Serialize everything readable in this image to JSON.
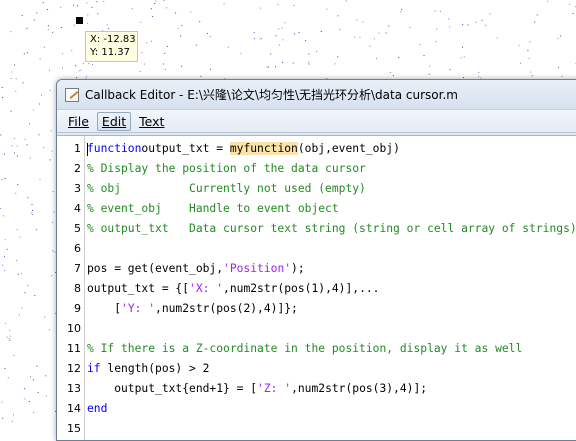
{
  "datatip": {
    "x_text": "X: -12.83",
    "y_text": "Y: 11.37"
  },
  "window": {
    "title": "Callback Editor - E:\\兴隆\\论文\\均匀性\\无挡光环分析\\data cursor.m"
  },
  "menu": {
    "file": "File",
    "edit": "Edit",
    "text": "Text"
  },
  "code": {
    "lines": [
      {
        "n": "1",
        "parts": [
          [
            "kw",
            "function"
          ],
          [
            "",
            "output_txt = "
          ],
          [
            "hl",
            "myfunction"
          ],
          [
            "",
            "(obj,event_obj)"
          ]
        ]
      },
      {
        "n": "2",
        "parts": [
          [
            "cm",
            "% Display the position of the data cursor"
          ]
        ]
      },
      {
        "n": "3",
        "parts": [
          [
            "cm",
            "% obj          Currently not used (empty)"
          ]
        ]
      },
      {
        "n": "4",
        "parts": [
          [
            "cm",
            "% event_obj    Handle to event object"
          ]
        ]
      },
      {
        "n": "5",
        "parts": [
          [
            "cm",
            "% output_txt   Data cursor text string (string or cell array of strings)."
          ]
        ]
      },
      {
        "n": "6",
        "parts": []
      },
      {
        "n": "7",
        "parts": [
          [
            "",
            "pos = get(event_obj,"
          ],
          [
            "st",
            "'Position'"
          ],
          [
            "",
            ");"
          ]
        ]
      },
      {
        "n": "8",
        "parts": [
          [
            "",
            "output_txt = {["
          ],
          [
            "st",
            "'X: '"
          ],
          [
            "",
            ",num2str(pos(1),4)],..."
          ]
        ]
      },
      {
        "n": "9",
        "parts": [
          [
            "",
            "    ["
          ],
          [
            "st",
            "'Y: '"
          ],
          [
            "",
            ",num2str(pos(2),4)]};"
          ]
        ]
      },
      {
        "n": "10",
        "parts": []
      },
      {
        "n": "11",
        "parts": [
          [
            "cm",
            "% If there is a Z-coordinate in the position, display it as well"
          ]
        ]
      },
      {
        "n": "12",
        "parts": [
          [
            "kw",
            "if"
          ],
          [
            "",
            " length(pos) > 2"
          ]
        ]
      },
      {
        "n": "13",
        "parts": [
          [
            "",
            "    output_txt{end+1} = ["
          ],
          [
            "st",
            "'Z: '"
          ],
          [
            "",
            ",num2str(pos(3),4)];"
          ]
        ]
      },
      {
        "n": "14",
        "parts": [
          [
            "kw",
            "end"
          ]
        ]
      },
      {
        "n": "15",
        "parts": []
      }
    ]
  },
  "colors": {
    "keyword": "#0000ff",
    "comment": "#228b22",
    "string": "#a020f0",
    "highlight": "#fbe2a8",
    "datatip_bg": "#ffffe1"
  },
  "icons": {
    "app": "editor-pencil-icon",
    "marker": "data-cursor-marker-icon"
  }
}
